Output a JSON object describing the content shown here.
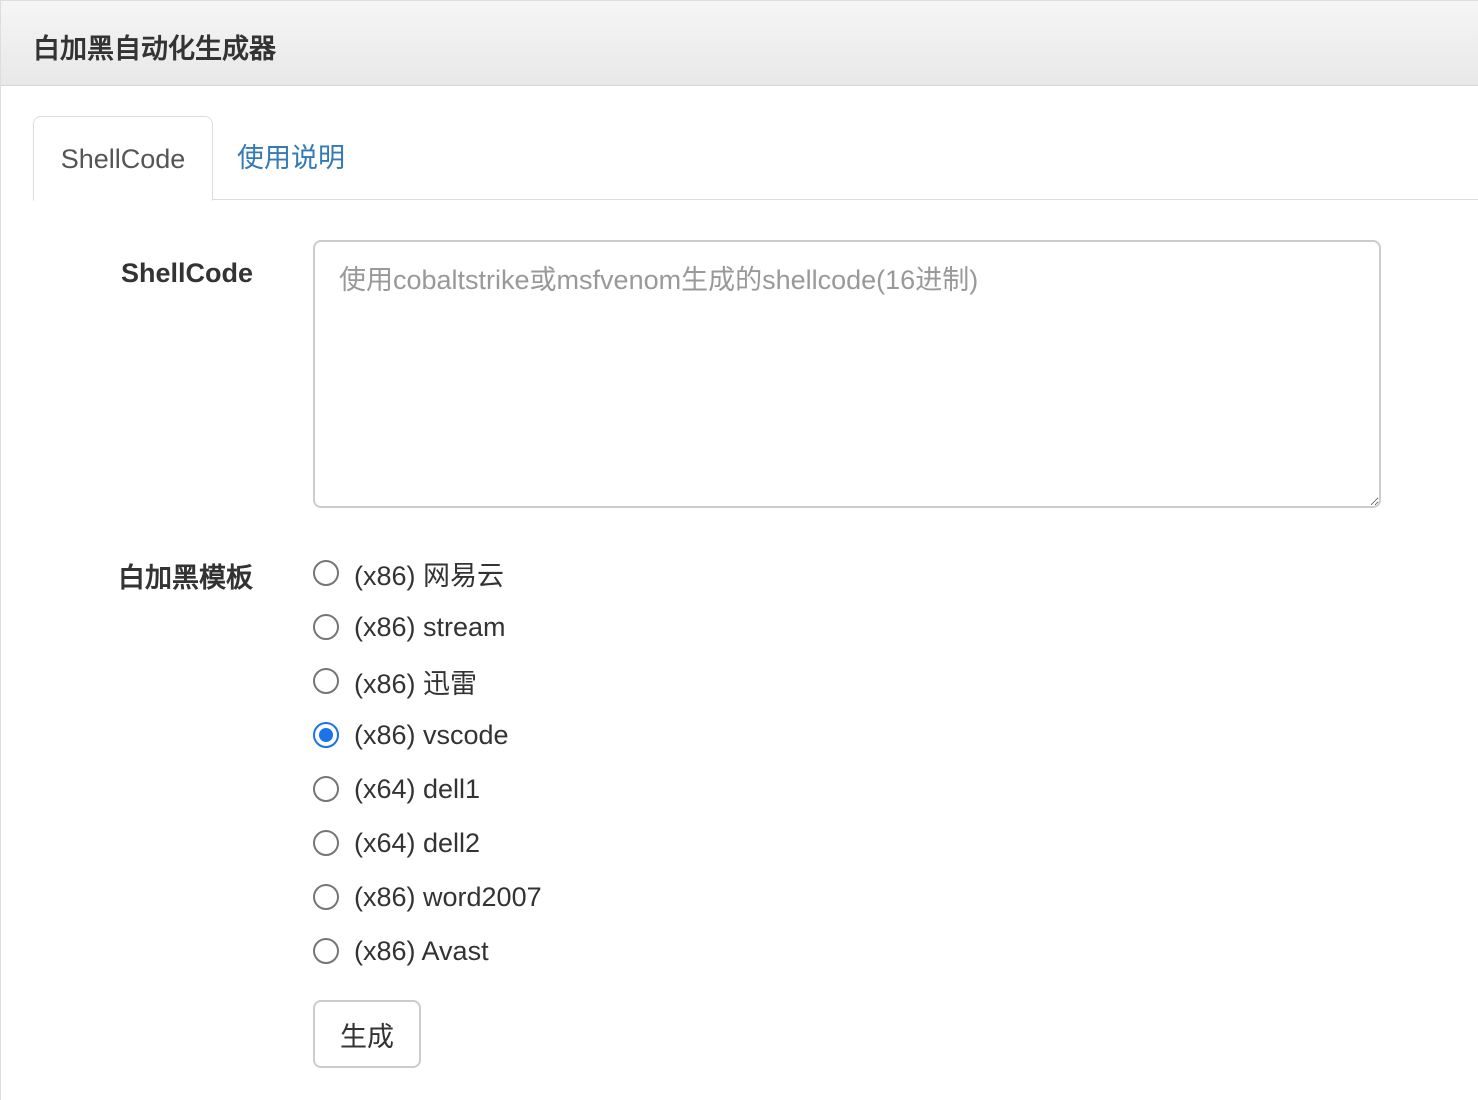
{
  "panel": {
    "title": "白加黑自动化生成器"
  },
  "tabs": [
    {
      "label": "ShellCode",
      "active": true
    },
    {
      "label": "使用说明",
      "active": false
    }
  ],
  "form": {
    "shellcode_label": "ShellCode",
    "shellcode_value": "",
    "shellcode_placeholder": "使用cobaltstrike或msfvenom生成的shellcode(16进制)",
    "template_label": "白加黑模板",
    "templates": [
      {
        "label": "(x86) 网易云",
        "checked": false
      },
      {
        "label": "(x86) stream",
        "checked": false
      },
      {
        "label": "(x86) 迅雷",
        "checked": false
      },
      {
        "label": "(x86) vscode",
        "checked": true
      },
      {
        "label": "(x64) dell1",
        "checked": false
      },
      {
        "label": "(x64) dell2",
        "checked": false
      },
      {
        "label": "(x86) word2007",
        "checked": false
      },
      {
        "label": "(x86) Avast",
        "checked": false
      }
    ],
    "submit_label": "生成"
  },
  "colors": {
    "link": "#337ab7",
    "radio_checked": "#1a73e8",
    "border": "#dddddd"
  }
}
